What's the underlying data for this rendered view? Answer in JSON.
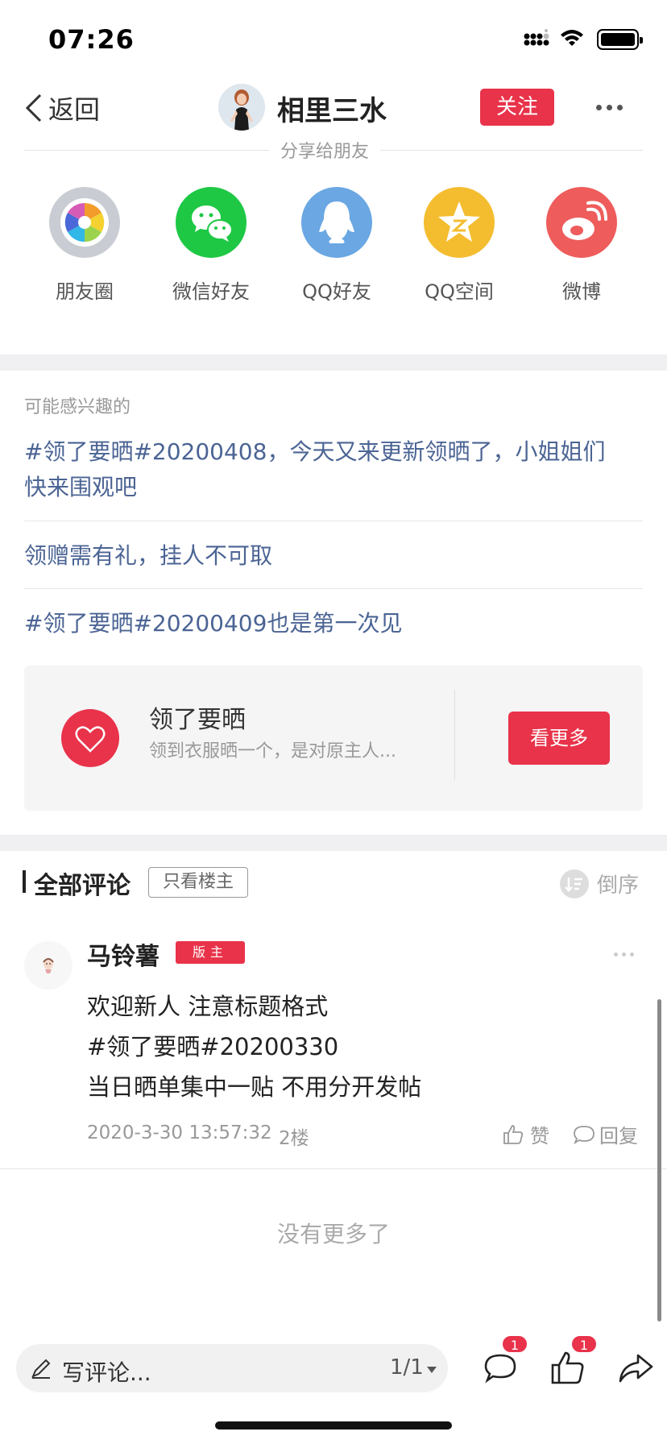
{
  "status_bar": {
    "time": "07:26"
  },
  "nav": {
    "back_label": "返回",
    "title": "相里三水",
    "follow_label": "关注"
  },
  "share": {
    "title": "分享给朋友",
    "items": [
      {
        "label": "朋友圈",
        "icon": "moments-icon",
        "color": "#c9cdd3"
      },
      {
        "label": "微信好友",
        "icon": "wechat-icon",
        "color": "#1ec845"
      },
      {
        "label": "QQ好友",
        "icon": "qq-icon",
        "color": "#6aa7e3"
      },
      {
        "label": "QQ空间",
        "icon": "qzone-icon",
        "color": "#f4bd30"
      },
      {
        "label": "微博",
        "icon": "weibo-icon",
        "color": "#ee5c5c"
      }
    ]
  },
  "interested": {
    "heading": "可能感兴趣的",
    "items": [
      {
        "line1": "#领了要晒#20200408，今天又来更新领晒了，小姐姐们",
        "line2": "快来围观吧"
      },
      {
        "line1": "领赠需有礼，挂人不可取"
      },
      {
        "line1": "#领了要晒#20200409也是第一次见"
      }
    ]
  },
  "topic": {
    "name": "领了要晒",
    "desc": "领到衣服晒一个，是对原主人...",
    "button": "看更多"
  },
  "comments": {
    "title": "全部评论",
    "only_host": "只看楼主",
    "order_label": "倒序",
    "items": [
      {
        "user": "马铃薯",
        "badge": "版主",
        "lines": [
          "欢迎新人 注意标题格式",
          "#领了要晒#20200330",
          "当日晒单集中一贴 不用分开发帖"
        ],
        "time": "2020-3-30 13:57:32",
        "floor": "2楼",
        "like_label": "赞",
        "reply_label": "回复"
      }
    ],
    "no_more": "没有更多了"
  },
  "bottom_bar": {
    "write_placeholder": "写评论...",
    "page": "1/1",
    "comment_count": "1",
    "like_count": "1"
  }
}
